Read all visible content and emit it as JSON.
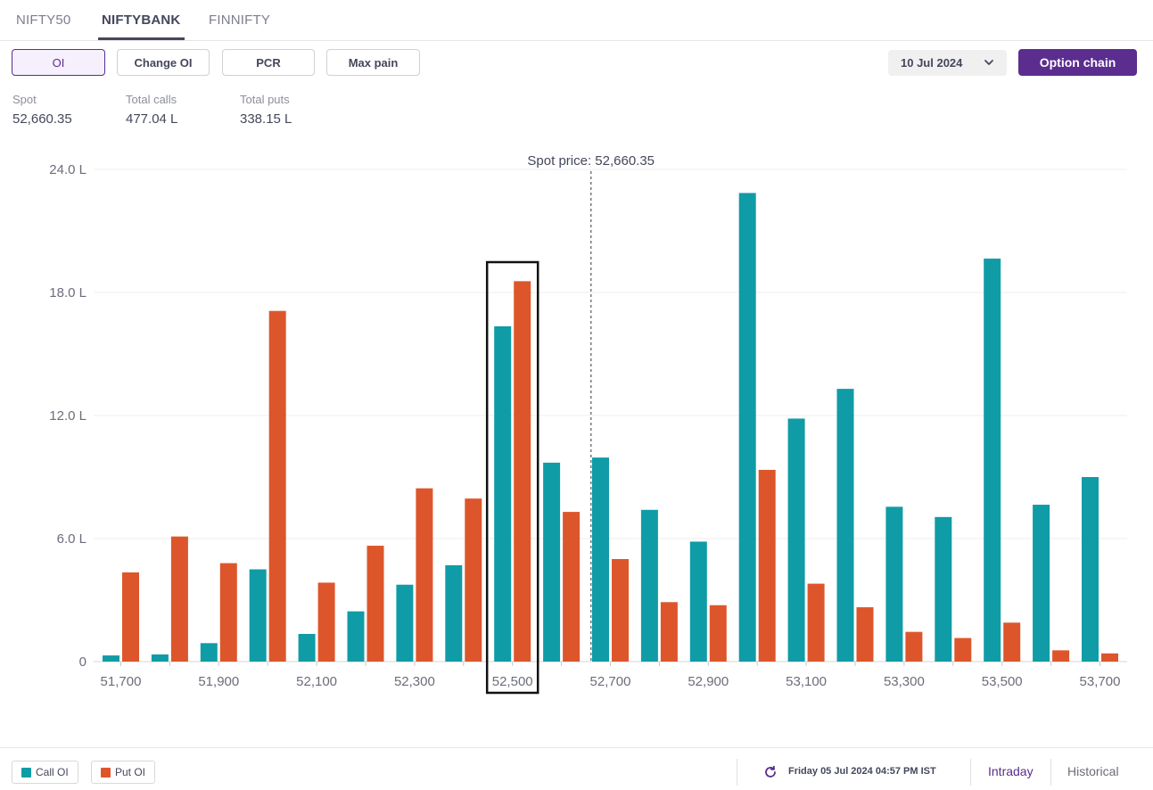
{
  "tabs": [
    {
      "label": "NIFTY50",
      "active": false
    },
    {
      "label": "NIFTYBANK",
      "active": true
    },
    {
      "label": "FINNIFTY",
      "active": false
    }
  ],
  "toolbar": {
    "buttons": [
      {
        "label": "OI",
        "active": true
      },
      {
        "label": "Change OI",
        "active": false
      },
      {
        "label": "PCR",
        "active": false
      },
      {
        "label": "Max pain",
        "active": false
      }
    ],
    "expiry": "10 Jul 2024",
    "option_chain_label": "Option chain"
  },
  "stats": {
    "spot": {
      "label": "Spot",
      "value": "52,660.35"
    },
    "calls": {
      "label": "Total calls",
      "value": "477.04 L"
    },
    "puts": {
      "label": "Total puts",
      "value": "338.15 L"
    }
  },
  "chart_data": {
    "type": "bar",
    "categories": [
      "51,700",
      "51,800",
      "51,900",
      "52,000",
      "52,100",
      "52,200",
      "52,300",
      "52,400",
      "52,500",
      "52,600",
      "52,700",
      "52,800",
      "52,900",
      "53,000",
      "53,100",
      "53,200",
      "53,300",
      "53,400",
      "53,500",
      "53,600",
      "53,700"
    ],
    "x_tick_labels": [
      "51,700",
      "51,900",
      "52,100",
      "52,300",
      "52,500",
      "52,700",
      "52,900",
      "53,100",
      "53,300",
      "53,500",
      "53,700"
    ],
    "series": [
      {
        "name": "Call OI",
        "color": "#109ca6",
        "values": [
          0.3,
          0.35,
          0.9,
          4.5,
          1.35,
          2.45,
          3.75,
          4.7,
          16.35,
          9.7,
          9.95,
          7.4,
          5.85,
          22.85,
          11.85,
          13.3,
          7.55,
          7.05,
          19.65,
          7.65,
          9.0
        ]
      },
      {
        "name": "Put OI",
        "color": "#dd562b",
        "values": [
          4.35,
          6.1,
          4.8,
          17.1,
          3.85,
          5.65,
          8.45,
          7.95,
          18.55,
          7.3,
          5.0,
          2.9,
          2.75,
          9.35,
          3.8,
          2.65,
          1.45,
          1.15,
          1.9,
          0.55,
          0.4
        ]
      }
    ],
    "y_tick_labels": [
      "0",
      "6.0 L",
      "12.0 L",
      "18.0 L",
      "24.0 L"
    ],
    "ylim": [
      0,
      24
    ],
    "unit": "L",
    "spot_annotation": "Spot price: 52,660.35",
    "spot_value": 52660.35,
    "highlighted_strike": "52,500",
    "grid": true
  },
  "footer": {
    "legend": [
      {
        "label": "Call OI",
        "color": "#109ca6"
      },
      {
        "label": "Put OI",
        "color": "#dd562b"
      }
    ],
    "updated": "Friday 05 Jul 2024 04:57 PM IST",
    "tabs": [
      {
        "label": "Intraday",
        "active": true
      },
      {
        "label": "Historical",
        "active": false
      }
    ]
  }
}
